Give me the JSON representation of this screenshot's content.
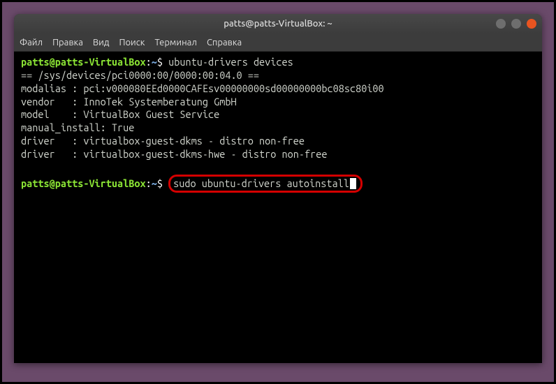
{
  "window": {
    "title": "patts@patts-VirtualBox: ~"
  },
  "menubar": {
    "items": [
      "Файл",
      "Правка",
      "Вид",
      "Поиск",
      "Терминал",
      "Справка"
    ]
  },
  "prompt": {
    "user_host": "patts@patts-VirtualBox",
    "separator": ":",
    "path": "~",
    "symbol": "$"
  },
  "terminal": {
    "command1": "ubuntu-drivers devices",
    "output_lines": [
      "== /sys/devices/pci0000:00/0000:00:04.0 ==",
      "modalias : pci:v000080EEd0000CAFEsv00000000sd00000000bc08sc80i00",
      "vendor   : InnoTek Systemberatung GmbH",
      "model    : VirtualBox Guest Service",
      "manual_install: True",
      "driver   : virtualbox-guest-dkms - distro non-free",
      "driver   : virtualbox-guest-dkms-hwe - distro non-free"
    ],
    "command2": "sudo ubuntu-drivers autoinstall"
  }
}
